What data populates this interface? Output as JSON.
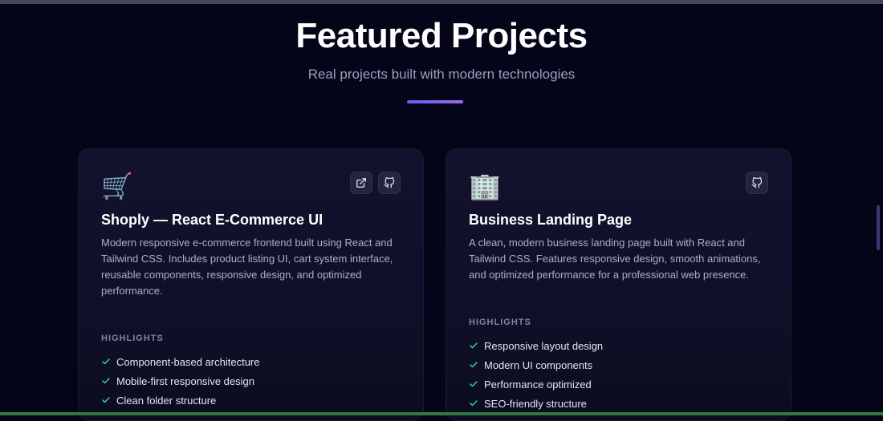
{
  "section": {
    "title": "Featured Projects",
    "subtitle": "Real projects built with modern technologies"
  },
  "highlights_label": "HIGHLIGHTS",
  "projects": [
    {
      "emoji": "🛒",
      "icon": "shopping-cart-icon",
      "title": "Shoply — React E-Commerce UI",
      "description": "Modern responsive e-commerce frontend built using React and Tailwind CSS. Includes product listing UI, cart system interface, reusable components, responsive design, and optimized performance.",
      "actions": [
        "external-link-icon",
        "github-icon"
      ],
      "highlights": [
        "Component-based architecture",
        "Mobile-first responsive design",
        "Clean folder structure"
      ]
    },
    {
      "emoji": "🏢",
      "icon": "office-building-icon",
      "title": "Business Landing Page",
      "description": "A clean, modern business landing page built with React and Tailwind CSS. Features responsive design, smooth animations, and optimized performance for a professional web presence.",
      "actions": [
        "github-icon"
      ],
      "highlights": [
        "Responsive layout design",
        "Modern UI components",
        "Performance optimized",
        "SEO-friendly structure"
      ]
    }
  ],
  "colors": {
    "background": "#05051a",
    "accent_gradient_start": "#6a5cf0",
    "accent_gradient_end": "#9b6ae8",
    "check": "#34d399"
  }
}
